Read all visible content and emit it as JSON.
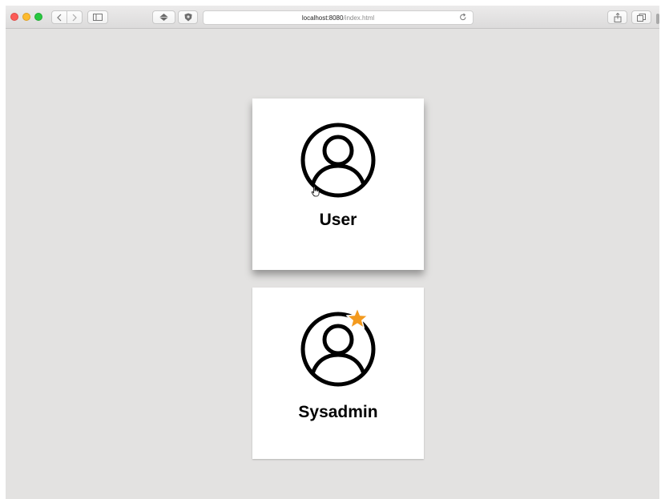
{
  "browser": {
    "url_host": "localhost:8080",
    "url_path": "/index.html",
    "icons": {
      "back": "chevron-left-icon",
      "forward": "chevron-right-icon",
      "sidebar": "sidebar-icon",
      "reload": "reload-icon",
      "share": "share-icon",
      "tabs": "tabs-icon"
    }
  },
  "cards": {
    "user": {
      "label": "User",
      "icon": "user-circle-icon"
    },
    "sysadmin": {
      "label": "Sysadmin",
      "icon": "user-circle-icon",
      "badge_icon": "star-icon"
    }
  },
  "colors": {
    "page_background": "#e3e2e1",
    "card_background": "#ffffff",
    "star": "#f39a1e"
  }
}
